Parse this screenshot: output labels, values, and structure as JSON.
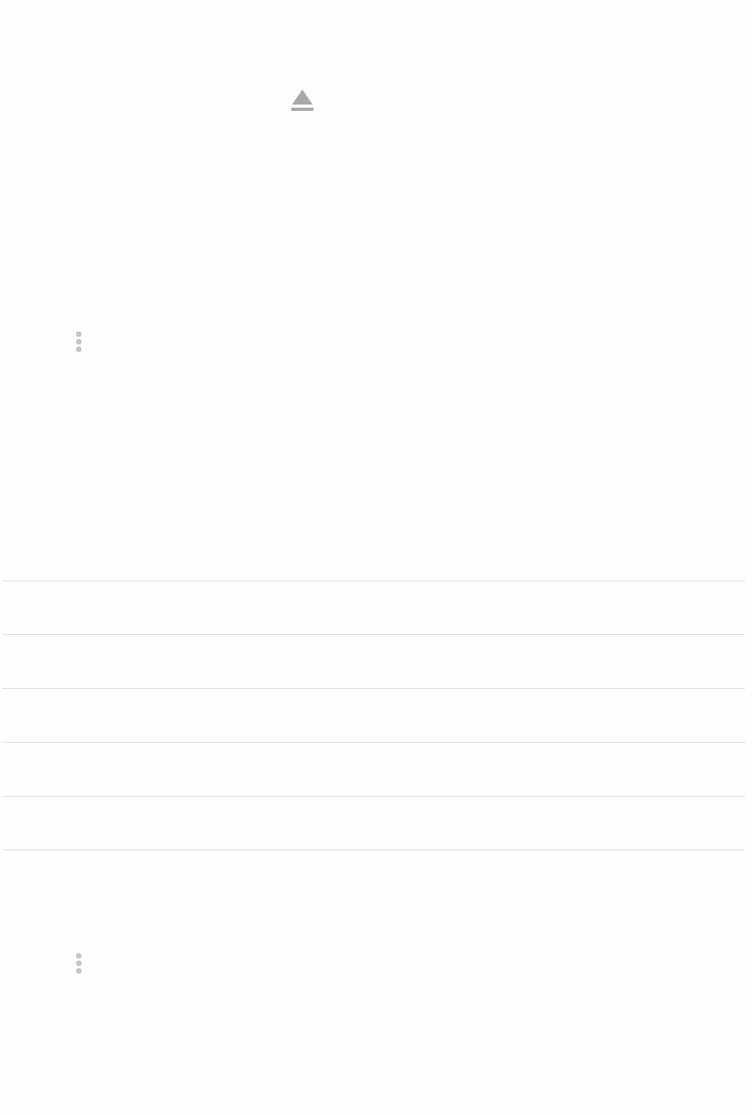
{
  "sections": [
    {
      "kind": "eject"
    },
    {
      "kind": "more"
    },
    {
      "kind": "rows",
      "rows": [
        {
          "kind": "blank"
        },
        {
          "kind": "blank"
        },
        {
          "kind": "blank"
        },
        {
          "kind": "blank"
        },
        {
          "kind": "blank"
        }
      ]
    },
    {
      "kind": "more"
    }
  ]
}
